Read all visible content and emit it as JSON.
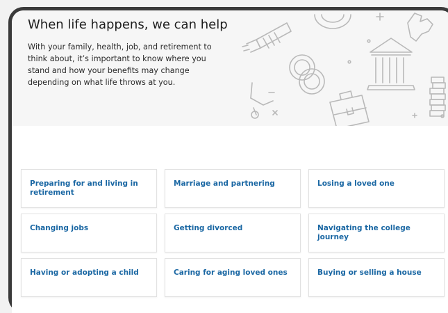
{
  "hero": {
    "title": "When life happens, we can help",
    "body": "With your family, health, job, and retirement to think about, it’s important to know where you stand and how your benefits may change depending on what life throws at you.",
    "illustration_icons": [
      "dumbbell-icon",
      "coin-icon",
      "plus-icon",
      "hand-icon",
      "rings-icon",
      "bank-building-icon",
      "scooter-icon",
      "briefcase-icon",
      "coin-stack-icon"
    ]
  },
  "colors": {
    "link": "#1a67a3",
    "hero_background": "#f6f6f6",
    "frame": "#3a3a3a"
  },
  "tiles": [
    {
      "label": "Preparing for and living in retirement"
    },
    {
      "label": "Marriage and partnering"
    },
    {
      "label": "Losing a loved one"
    },
    {
      "label": "Changing jobs"
    },
    {
      "label": "Getting divorced"
    },
    {
      "label": "Navigating the college journey"
    },
    {
      "label": "Having or adopting a child"
    },
    {
      "label": "Caring for aging loved ones"
    },
    {
      "label": "Buying or selling a house"
    }
  ]
}
